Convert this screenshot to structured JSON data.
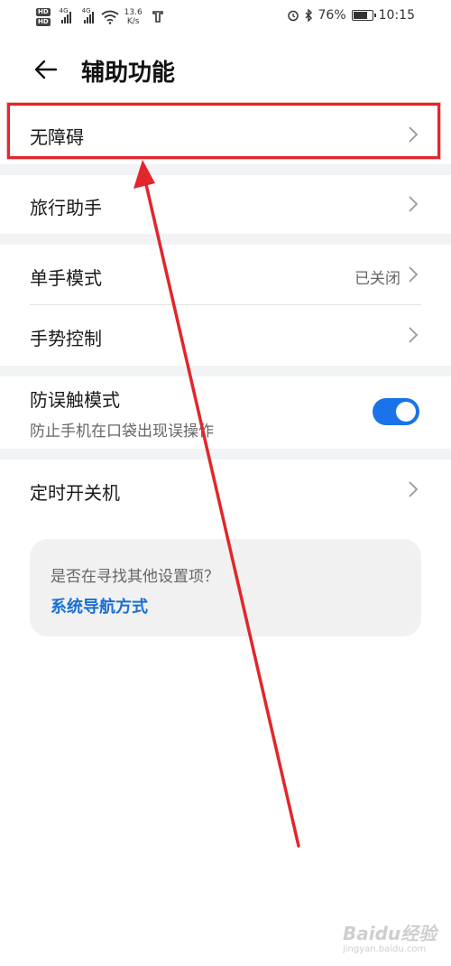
{
  "status_bar": {
    "hd1": "HD",
    "hd2": "HD",
    "signal1_label": "4G",
    "signal2_label": "4G",
    "speed_value": "13.6",
    "speed_unit": "K/s",
    "battery_percent": "76%",
    "battery_level": 0.76,
    "time": "10:15"
  },
  "header": {
    "title": "辅助功能"
  },
  "items": {
    "accessibility": {
      "label": "无障碍"
    },
    "travel_assistant": {
      "label": "旅行助手"
    },
    "one_hand_mode": {
      "label": "单手模式",
      "value": "已关闭"
    },
    "gesture_control": {
      "label": "手势控制"
    },
    "accidental_touch": {
      "label": "防误触模式",
      "sub": "防止手机在口袋出现误操作",
      "enabled": true
    },
    "scheduled_power": {
      "label": "定时开关机"
    }
  },
  "suggestion_card": {
    "question": "是否在寻找其他设置项？",
    "link": "系统导航方式"
  },
  "watermark": {
    "text": "Baidu经验",
    "sub": "jingyan.baidu.com"
  },
  "colors": {
    "accent": "#1a73e8",
    "annotation_red": "#e2262b",
    "link": "#1a6fd4"
  }
}
